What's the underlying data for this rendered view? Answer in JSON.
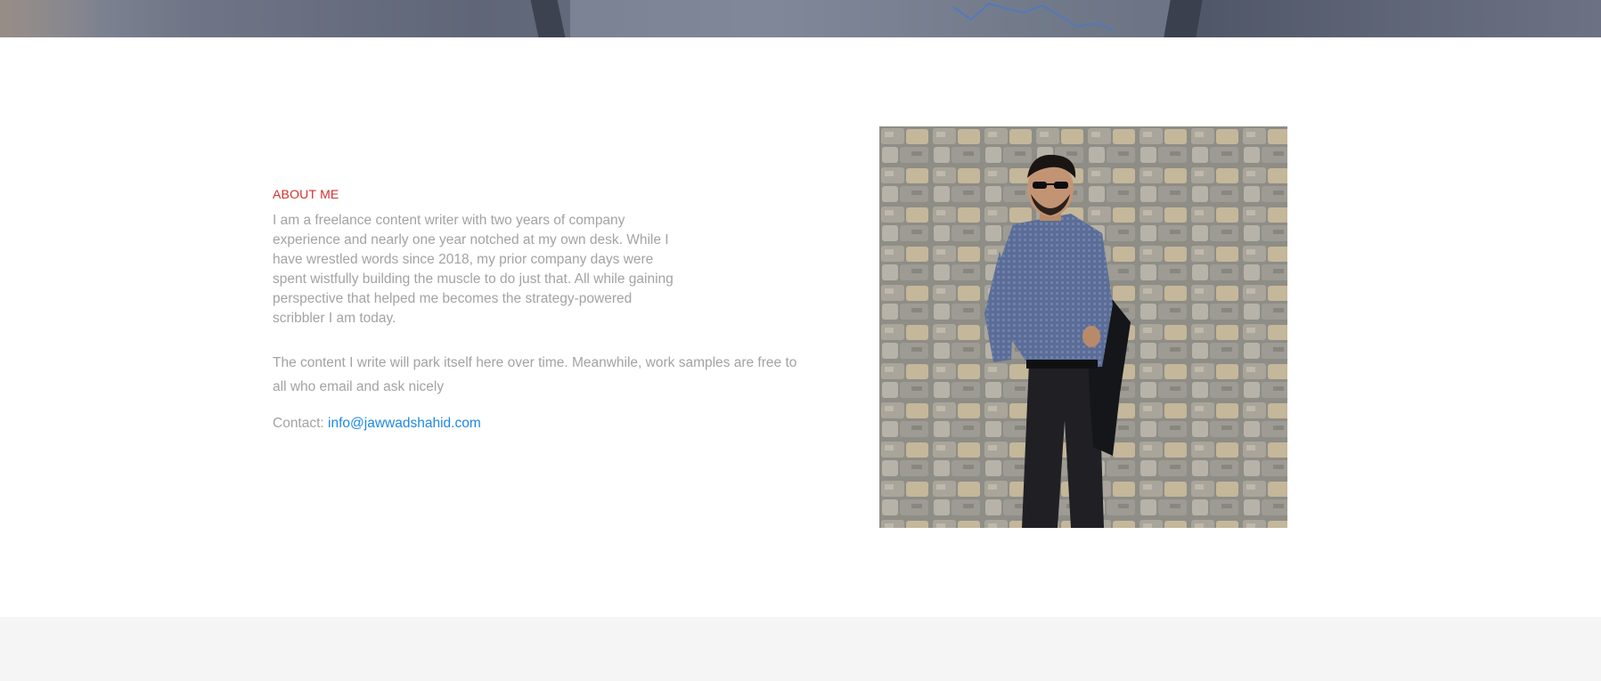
{
  "about": {
    "heading": "ABOUT ME",
    "paragraph1": "I am a freelance content writer with two years of company experience and nearly one year notched at my own desk. While I have wrestled words since 2018, my prior company days were spent wistfully building the muscle to do just that. All while gaining perspective that helped me becomes the strategy-powered scribbler I am today.",
    "paragraph2": "The content I write will park itself here over time. Meanwhile, work samples are free to all who email and ask nicely",
    "contact_label": "Contact:",
    "contact_email": "info@jawwadshahid.com"
  },
  "colors": {
    "heading": "#d32f2f",
    "body_text": "#a3a3a3",
    "link": "#1e88e5",
    "footer_bg": "#f5f5f5"
  },
  "icons": {
    "photo": "portrait-photo"
  }
}
